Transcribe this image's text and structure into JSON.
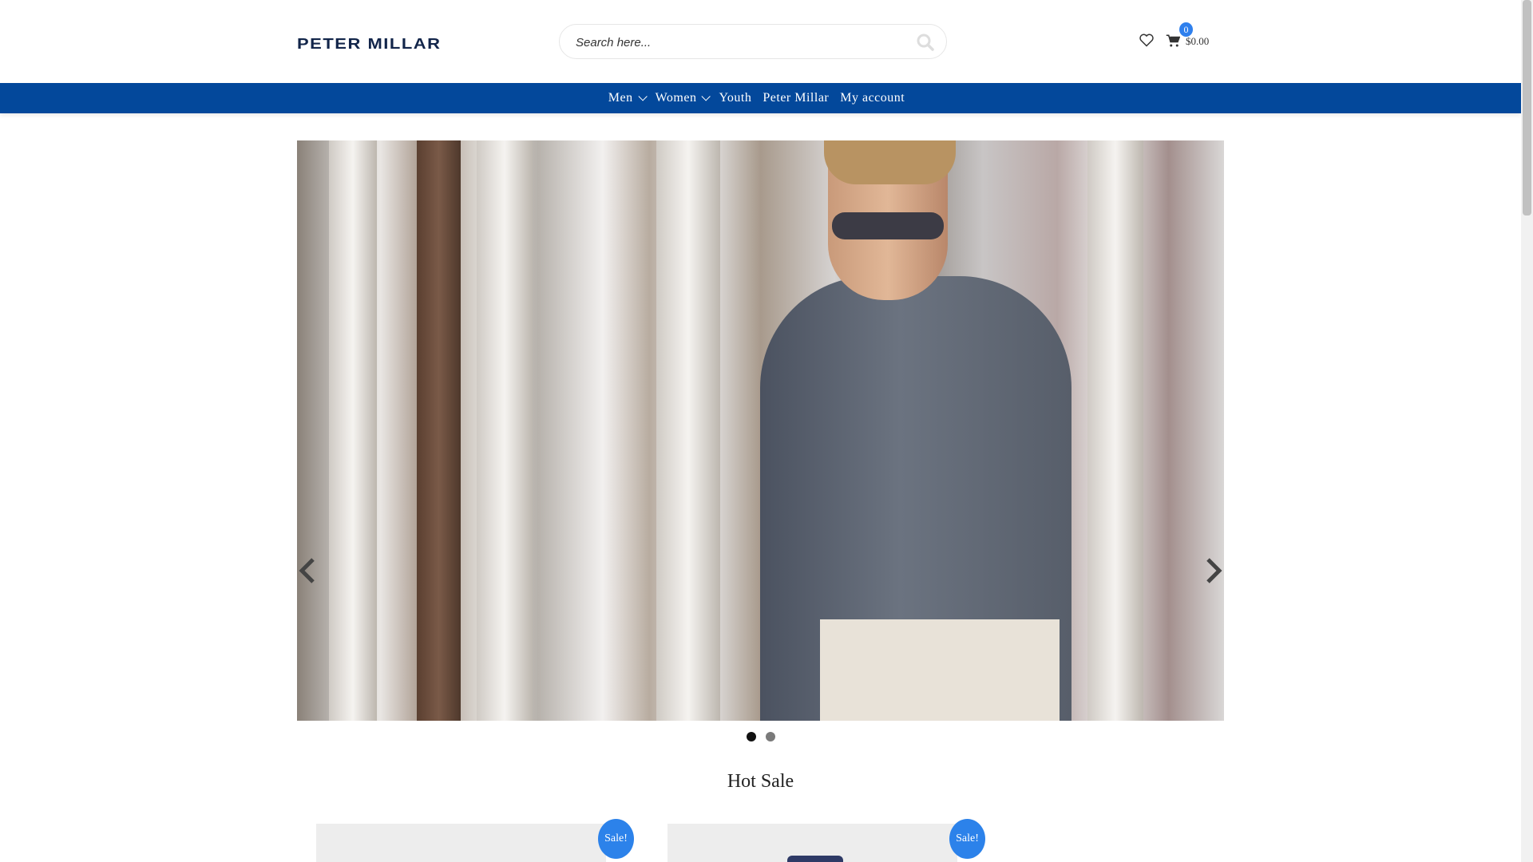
{
  "header": {
    "logo": "PETER MILLAR",
    "search_placeholder": "Search here...",
    "cart_count": "0",
    "cart_total": "$0.00"
  },
  "nav": {
    "items": [
      {
        "label": "Men"
      },
      {
        "label": "Women"
      },
      {
        "label": "Youth"
      },
      {
        "label": "Peter Millar"
      },
      {
        "label": "My account"
      }
    ]
  },
  "hero": {
    "slides": 2,
    "active_slide": 1
  },
  "hot_sale": {
    "title": "Hot Sale",
    "products": [
      {
        "badge": "Sale!"
      },
      {
        "badge": "Sale!"
      }
    ]
  },
  "colors": {
    "nav_bg": "#03489b",
    "badge": "#2c82ea",
    "logo": "#12254a"
  }
}
